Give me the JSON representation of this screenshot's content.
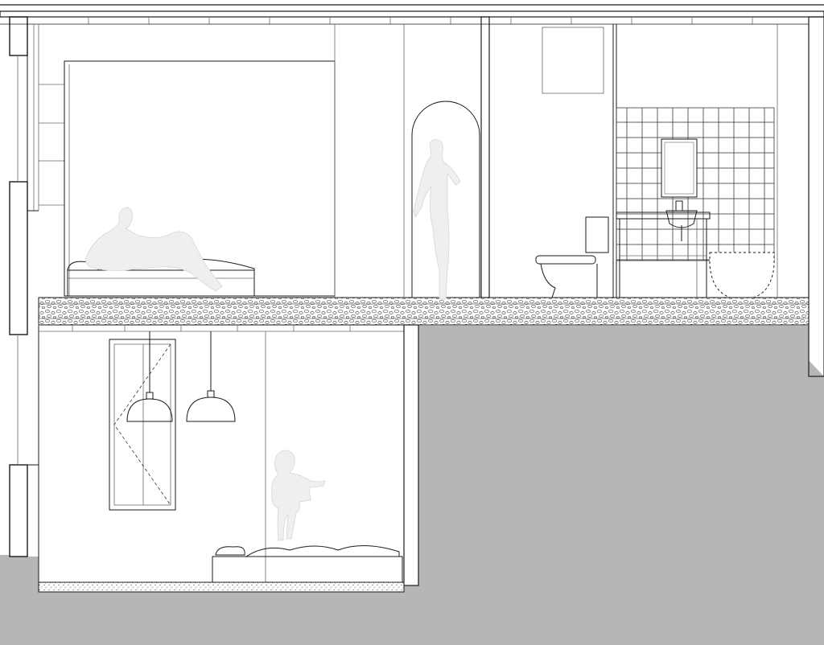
{
  "drawing": {
    "kind": "architectural-section",
    "colors": {
      "background": "#ffffff",
      "ground": "#b6b6b6",
      "line": "#1a1a1a",
      "figure": "#efefef",
      "figure_outline": "#d6d6d6",
      "slab_hatch": "#555555"
    },
    "labels": []
  }
}
